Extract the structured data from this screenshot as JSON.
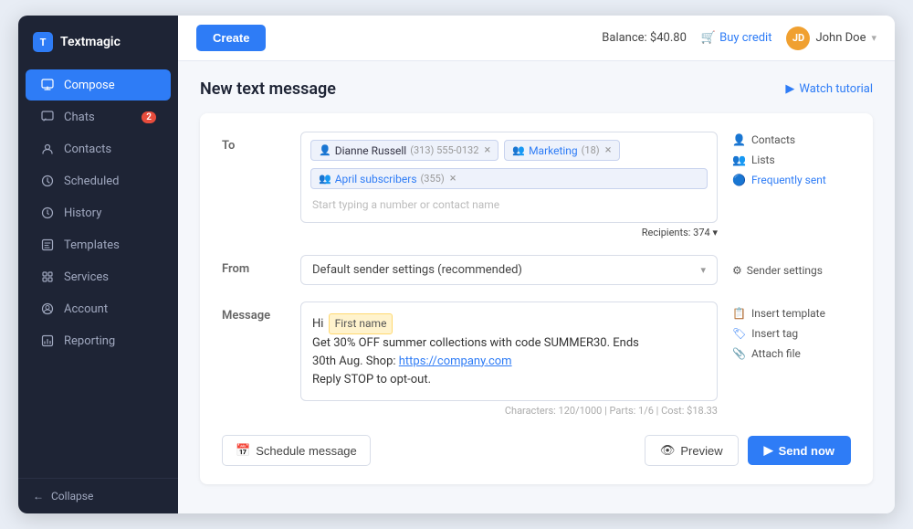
{
  "app": {
    "name": "Textmagic"
  },
  "sidebar": {
    "items": [
      {
        "id": "compose",
        "label": "Compose",
        "icon": "✉",
        "active": true,
        "badge": null
      },
      {
        "id": "chats",
        "label": "Chats",
        "icon": "💬",
        "active": false,
        "badge": "2"
      },
      {
        "id": "contacts",
        "label": "Contacts",
        "icon": "👥",
        "active": false,
        "badge": null
      },
      {
        "id": "scheduled",
        "label": "Scheduled",
        "icon": "🕐",
        "active": false,
        "badge": null
      },
      {
        "id": "history",
        "label": "History",
        "icon": "🕓",
        "active": false,
        "badge": null
      },
      {
        "id": "templates",
        "label": "Templates",
        "icon": "📄",
        "active": false,
        "badge": null
      },
      {
        "id": "services",
        "label": "Services",
        "icon": "⚙",
        "active": false,
        "badge": null
      },
      {
        "id": "account",
        "label": "Account",
        "icon": "👤",
        "active": false,
        "badge": null
      },
      {
        "id": "reporting",
        "label": "Reporting",
        "icon": "📊",
        "active": false,
        "badge": null
      }
    ],
    "collapse_label": "Collapse"
  },
  "topbar": {
    "create_label": "Create",
    "balance_label": "Balance: $40.80",
    "buy_credit_label": "Buy credit",
    "user_name": "John Doe",
    "user_initials": "JD"
  },
  "page": {
    "title": "New text message",
    "watch_tutorial_label": "Watch tutorial"
  },
  "to_field": {
    "tags": [
      {
        "type": "contact",
        "label": "Dianne Russell",
        "detail": "(313) 555-0132"
      },
      {
        "type": "list",
        "label": "Marketing",
        "detail": "(18)"
      },
      {
        "type": "list",
        "label": "April subscribers",
        "detail": "(355)"
      }
    ],
    "placeholder": "Start typing a number or contact name",
    "recipients_label": "Recipients: 374",
    "dropdown_icon": "▾"
  },
  "side_links": {
    "contacts_label": "Contacts",
    "lists_label": "Lists",
    "frequently_sent_label": "Frequently sent"
  },
  "from_field": {
    "value": "Default sender settings (recommended)",
    "sender_settings_label": "Sender settings"
  },
  "message_field": {
    "prefix": "Hi",
    "first_name_tag": "First name",
    "body_line1": "Get 30% OFF summer collections with code SUMMER30. Ends",
    "body_line2": "30th Aug. Shop:",
    "link": "https://company.com",
    "body_line3": "Reply STOP to opt-out.",
    "char_count": "Characters: 120/1000  |  Parts: 1/6  |  Cost: $18.33"
  },
  "message_side_links": {
    "insert_template_label": "Insert template",
    "insert_tag_label": "Insert tag",
    "attach_file_label": "Attach file"
  },
  "actions": {
    "schedule_label": "Schedule message",
    "preview_label": "Preview",
    "send_label": "Send now"
  }
}
